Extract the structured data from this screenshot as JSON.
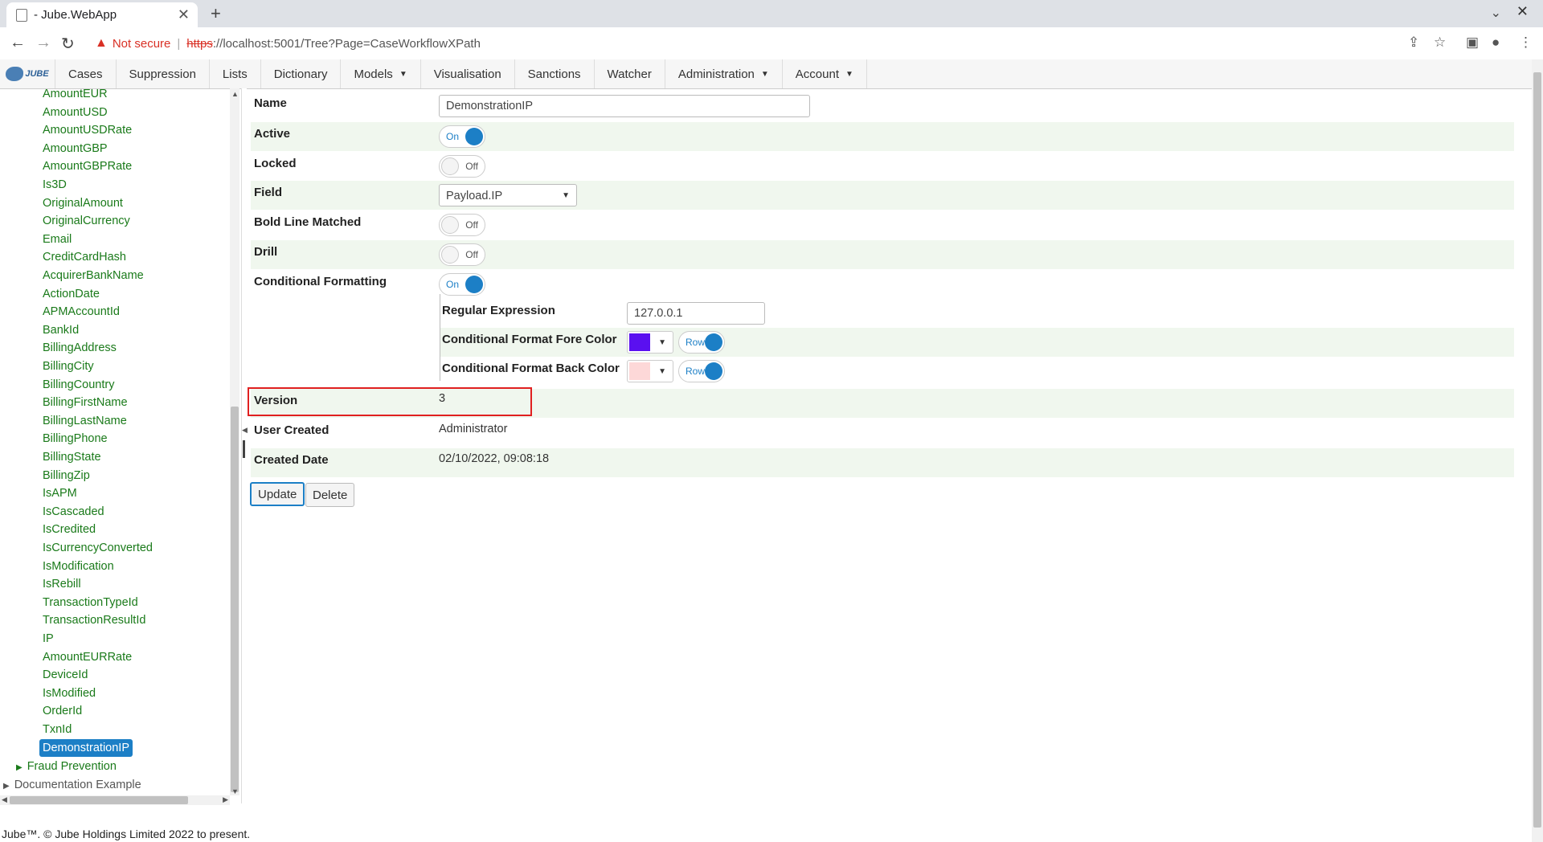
{
  "browser": {
    "tab_title": "- Jube.WebApp",
    "not_secure": "Not secure",
    "url_scheme": "https",
    "url_rest": "://localhost:5001/Tree?Page=CaseWorkflowXPath"
  },
  "nav": {
    "logo_text": "JUBE",
    "items": [
      "Cases",
      "Suppression",
      "Lists",
      "Dictionary",
      "Models",
      "Visualisation",
      "Sanctions",
      "Watcher",
      "Administration",
      "Account"
    ]
  },
  "tree": {
    "items": [
      "AmountEUR",
      "AmountUSD",
      "AmountUSDRate",
      "AmountGBP",
      "AmountGBPRate",
      "Is3D",
      "OriginalAmount",
      "OriginalCurrency",
      "Email",
      "CreditCardHash",
      "AcquirerBankName",
      "ActionDate",
      "APMAccountId",
      "BankId",
      "BillingAddress",
      "BillingCity",
      "BillingCountry",
      "BillingFirstName",
      "BillingLastName",
      "BillingPhone",
      "BillingState",
      "BillingZip",
      "IsAPM",
      "IsCascaded",
      "IsCredited",
      "IsCurrencyConverted",
      "IsModification",
      "IsRebill",
      "TransactionTypeId",
      "TransactionResultId",
      "IP",
      "AmountEURRate",
      "DeviceId",
      "IsModified",
      "OrderId",
      "TxnId"
    ],
    "selected": "DemonstrationIP",
    "fraud_prevention": "Fraud Prevention",
    "documentation_example": "Documentation Example"
  },
  "form": {
    "name_label": "Name",
    "name_value": "DemonstrationIP",
    "active_label": "Active",
    "locked_label": "Locked",
    "field_label": "Field",
    "field_value": "Payload.IP",
    "bold_label": "Bold Line Matched",
    "drill_label": "Drill",
    "cond_label": "Conditional Formatting",
    "regex_label": "Regular Expression",
    "regex_value": "127.0.0.1",
    "fore_label": "Conditional Format Fore Color",
    "back_label": "Conditional Format Back Color",
    "version_label": "Version",
    "version_value": "3",
    "user_label": "User Created",
    "user_value": "Administrator",
    "created_label": "Created Date",
    "created_value": "02/10/2022, 09:08:18",
    "on": "On",
    "off": "Off",
    "row": "Row",
    "update": "Update",
    "delete": "Delete"
  },
  "colors": {
    "fore": "#5a10f0",
    "back": "#fdd8d8",
    "accent": "#1c7fc6"
  },
  "footer": "Jube™. © Jube Holdings Limited 2022 to present."
}
